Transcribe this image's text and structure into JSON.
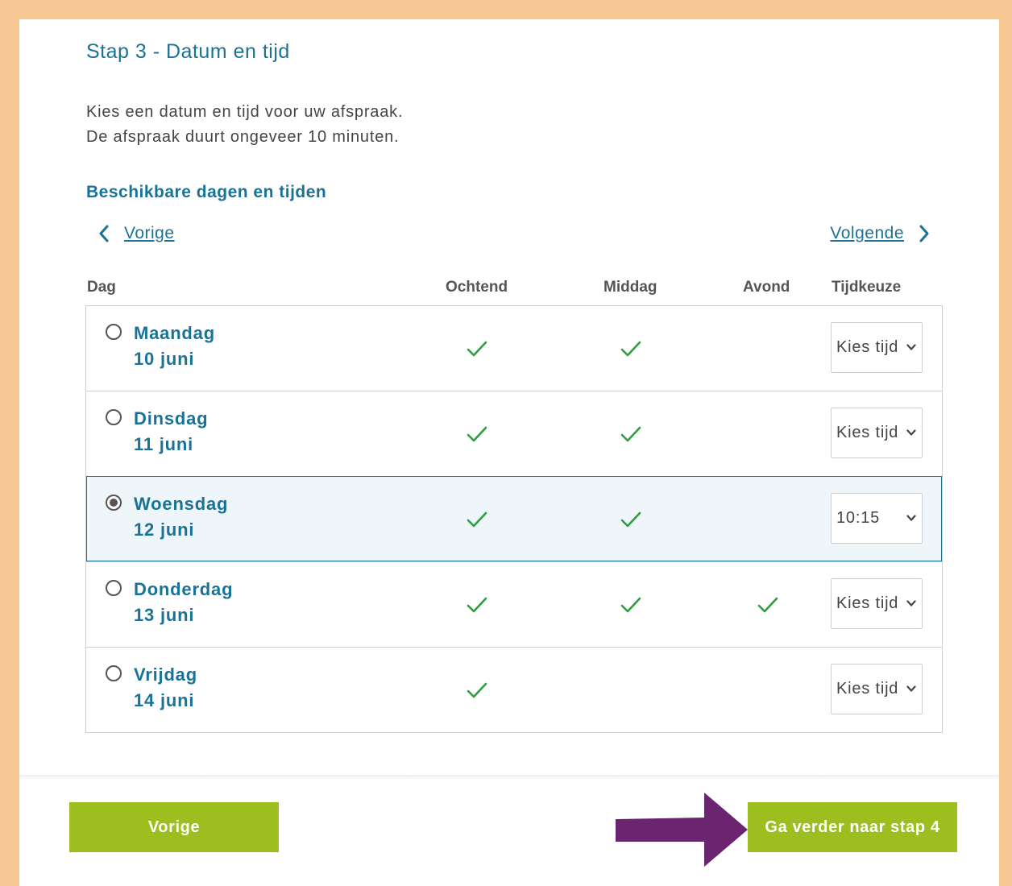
{
  "header": {
    "step_title": "Stap 3 - Datum en tijd",
    "intro_line1": "Kies een datum en tijd voor uw afspraak.",
    "intro_line2": "De afspraak duurt ongeveer 10 minuten.",
    "section_title": "Beschikbare dagen en tijden"
  },
  "nav": {
    "prev_label": "Vorige",
    "next_label": "Volgende"
  },
  "table": {
    "headers": {
      "dag": "Dag",
      "ochtend": "Ochtend",
      "middag": "Middag",
      "avond": "Avond",
      "tijdkeuze": "Tijdkeuze"
    },
    "rows": [
      {
        "day": "Maandag",
        "date": "10 juni",
        "ochtend": true,
        "middag": true,
        "avond": false,
        "select": "Kies tijd",
        "selected": false
      },
      {
        "day": "Dinsdag",
        "date": "11 juni",
        "ochtend": true,
        "middag": true,
        "avond": false,
        "select": "Kies tijd",
        "selected": false
      },
      {
        "day": "Woensdag",
        "date": "12 juni",
        "ochtend": true,
        "middag": true,
        "avond": false,
        "select": "10:15",
        "selected": true
      },
      {
        "day": "Donderdag",
        "date": "13 juni",
        "ochtend": true,
        "middag": true,
        "avond": true,
        "select": "Kies tijd",
        "selected": false
      },
      {
        "day": "Vrijdag",
        "date": "14 juni",
        "ochtend": true,
        "middag": false,
        "avond": false,
        "select": "Kies tijd",
        "selected": false
      }
    ]
  },
  "footer": {
    "prev_button": "Vorige",
    "next_button": "Ga verder naar stap 4"
  },
  "colors": {
    "outer_background": "#f7c794",
    "heading_blue": "#1a7396",
    "check_green": "#2e9e3f",
    "button_green": "#9cbf1f",
    "arrow_purple": "#6b2470"
  },
  "icons": {
    "nav_prev": "chevron-left-icon",
    "nav_next": "chevron-right-icon",
    "availability": "checkmark-icon",
    "select_caret": "chevron-down-icon",
    "callout": "arrow-right-icon"
  }
}
